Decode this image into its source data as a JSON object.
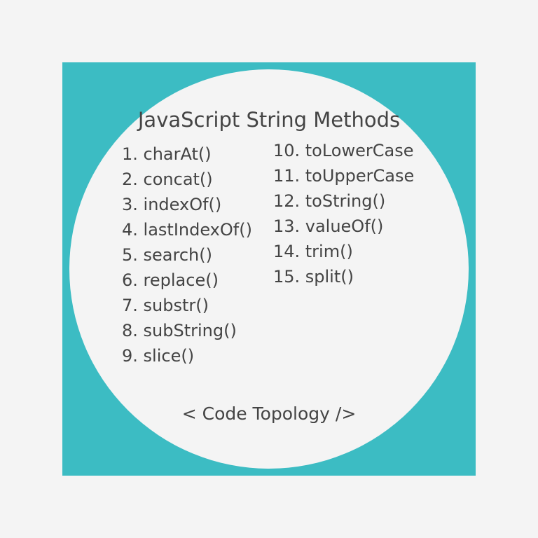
{
  "title": "JavaScript String Methods",
  "left_items": [
    "1. charAt()",
    "2. concat()",
    "3. indexOf()",
    "4. lastIndexOf()",
    "5. search()",
    "6. replace()",
    "7. substr()",
    "8. subString()",
    "9. slice()"
  ],
  "right_items": [
    "10. toLowerCase",
    "11. toUpperCase",
    "12. toString()",
    "13. valueOf()",
    "14. trim()",
    "15. split()"
  ],
  "footer": "< Code Topology />"
}
